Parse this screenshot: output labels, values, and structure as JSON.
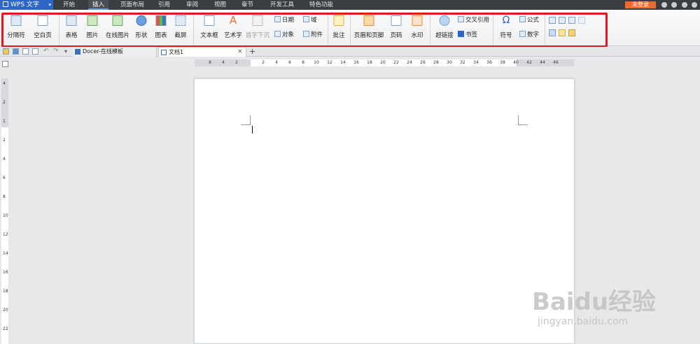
{
  "app": {
    "name": "WPS 文字"
  },
  "menu": {
    "tabs": [
      "开始",
      "插入",
      "页面布局",
      "引用",
      "审阅",
      "视图",
      "章节",
      "开发工具",
      "特色功能"
    ],
    "active": "插入",
    "login": "未登录"
  },
  "ribbon": {
    "page_break": "分隔符",
    "blank_page": "空白页",
    "table": "表格",
    "picture": "图片",
    "online_picture": "在线图片",
    "shape": "形状",
    "chart": "图表",
    "screenshot": "截屏",
    "textbox": "文本框",
    "wordart": "艺术字",
    "dropcap": "首字下沉",
    "date": "日期",
    "object": "对象",
    "text_part": "域",
    "attachment": "附件",
    "comment": "批注",
    "header_footer": "页眉和页脚",
    "page_number": "页码",
    "watermark": "水印",
    "hyperlink": "超链接",
    "cross_ref": "交叉引用",
    "bookmark": "书签",
    "symbol": "符号",
    "formula": "公式",
    "number": "数字"
  },
  "tabs_row": {
    "docer": "Docer-在线模板",
    "doc1": "文档1"
  },
  "ruler": {
    "h_numbers": [
      "6",
      "4",
      "2",
      "2",
      "4",
      "6",
      "8",
      "10",
      "12",
      "14",
      "16",
      "18",
      "20",
      "22",
      "24",
      "26",
      "28",
      "30",
      "32",
      "34",
      "36",
      "38",
      "40",
      "42",
      "44",
      "46"
    ],
    "v_numbers": [
      "4",
      "2",
      "1",
      "2",
      "4",
      "6",
      "8",
      "10",
      "12",
      "14",
      "16",
      "18",
      "20",
      "22"
    ]
  },
  "watermark": {
    "brand": "Baidu经验",
    "url": "jingyan.baidu.com"
  },
  "colors": {
    "accent": "#2c66c6",
    "menubar": "#3a3d42",
    "highlight": "#e3171d",
    "login": "#e96d2e"
  }
}
